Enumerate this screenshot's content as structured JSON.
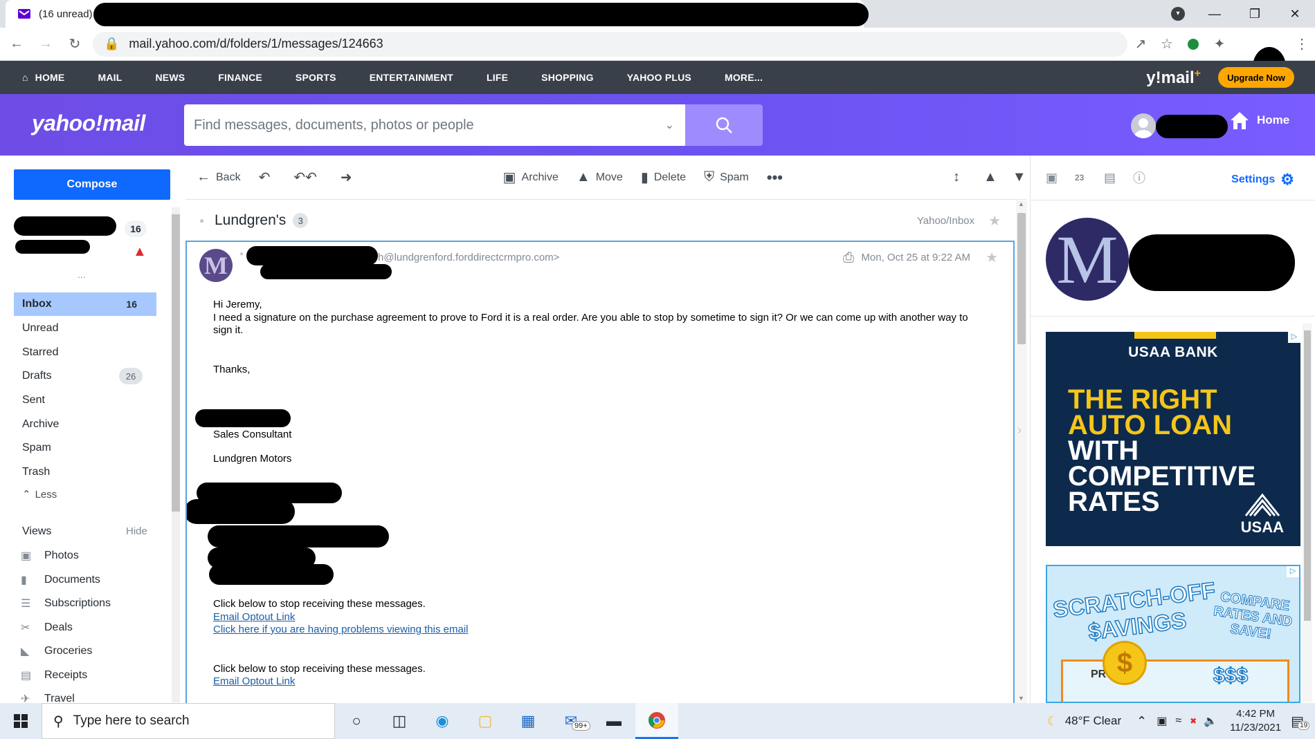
{
  "browser": {
    "tab_title": "(16 unread)",
    "url": "mail.yahoo.com/d/folders/1/messages/124663",
    "window_controls": [
      "—",
      "❐",
      "✕"
    ]
  },
  "ynav": {
    "items": [
      "HOME",
      "MAIL",
      "NEWS",
      "FINANCE",
      "SPORTS",
      "ENTERTAINMENT",
      "LIFE",
      "SHOPPING",
      "YAHOO PLUS",
      "MORE..."
    ],
    "brand": "y!mail",
    "brand_plus": "+",
    "upgrade": "Upgrade Now"
  },
  "header": {
    "logo": "yahoo!mail",
    "search_placeholder": "Find messages, documents, photos or people",
    "home": "Home"
  },
  "sidebar": {
    "compose": "Compose",
    "account_count": "16",
    "ellipsis": "...",
    "folders": [
      {
        "label": "Inbox",
        "count": "16"
      },
      {
        "label": "Unread",
        "count": ""
      },
      {
        "label": "Starred",
        "count": ""
      },
      {
        "label": "Drafts",
        "count": "26"
      },
      {
        "label": "Sent",
        "count": ""
      },
      {
        "label": "Archive",
        "count": ""
      },
      {
        "label": "Spam",
        "count": ""
      },
      {
        "label": "Trash",
        "count": ""
      }
    ],
    "less": "Less",
    "views_label": "Views",
    "views_hide": "Hide",
    "views": [
      "Photos",
      "Documents",
      "Subscriptions",
      "Deals",
      "Groceries",
      "Receipts",
      "Travel"
    ]
  },
  "toolbar": {
    "back": "Back",
    "archive": "Archive",
    "move": "Move",
    "delete": "Delete",
    "spam": "Spam"
  },
  "message": {
    "subject": "Lundgren's",
    "thread_count": "3",
    "folder_path": "Yahoo/Inbox",
    "sender_initial": "M",
    "sender_email": "h@lundgrenford.forddirectcrmpro.com>",
    "date": "Mon, Oct 25 at 9:22 AM",
    "greeting": "Hi Jeremy,",
    "body": "I need a signature on the purchase agreement to prove to Ford it is a real order. Are you able to stop by sometime to sign it? Or we can come up with another way to sign it.",
    "thanks": "Thanks,",
    "title": "Sales Consultant",
    "company": "Lundgren Motors",
    "stop_text": "Click below to stop receiving these messages.",
    "optout_link": "Email Optout Link",
    "view_problem_link": "Click here if you are having problems viewing this email",
    "stop_text_2": "Click below to stop receiving these messages.",
    "optout_link_2": "Email Optout Link"
  },
  "rightrail": {
    "settings": "Settings",
    "calendar_date": "23",
    "contact_initial": "M",
    "ad1": {
      "bank": "USAA BANK",
      "line1": "THE RIGHT",
      "line2": "AUTO LOAN",
      "line3": "WITH",
      "line4": "COMPETITIVE",
      "line5": "RATES",
      "brand": "USAA"
    },
    "ad2": {
      "line1": "SCRATCH-OFF",
      "line2": "$AVINGS",
      "compare1": "COMPARE",
      "compare2": "RATES AND",
      "compare3": "SAVE!",
      "coin": "$",
      "dollars": "$$$",
      "pr": "PR"
    }
  },
  "taskbar": {
    "search_placeholder": "Type here to search",
    "mail_badge": "99+",
    "weather": "48°F  Clear",
    "time": "4:42 PM",
    "date": "11/23/2021",
    "notifications": "19"
  }
}
